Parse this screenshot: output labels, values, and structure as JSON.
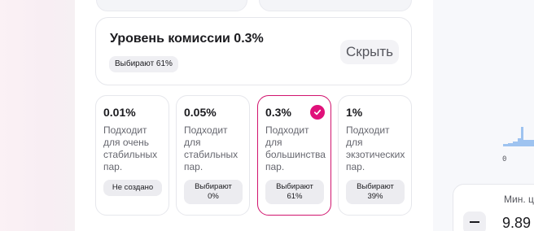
{
  "fee_summary": {
    "title": "Уровень комиссии 0.3%",
    "popularity": "Выбирают 61%",
    "hide_label": "Скрыть"
  },
  "tiers": [
    {
      "percent": "0.01%",
      "description": "Подходит\nдля очень\nстабильных\nпар.",
      "badge": "Не создано",
      "selected": false
    },
    {
      "percent": "0.05%",
      "description": "Подходит\nдля\nстабильных\nпар.",
      "badge_line1": "Выбирают",
      "badge_line2": "0%",
      "selected": false
    },
    {
      "percent": "0.3%",
      "description": "Подходит\nдля\nбольшинства\nпар.",
      "badge_line1": "Выбирают",
      "badge_line2": "61%",
      "selected": true
    },
    {
      "percent": "1%",
      "description": "Подходит\nдля\nэкзотических\nпар.",
      "badge_line1": "Выбирают",
      "badge_line2": "39%",
      "selected": false
    }
  ],
  "right_panel": {
    "axis_zero": "0",
    "min_label": "Мин. ц",
    "min_value": "9.89"
  },
  "colors": {
    "accent": "#e0117a",
    "selected_border": "#d1146e",
    "chart_bar": "#9ec3f0"
  },
  "icons": {
    "selected_check": "check-icon",
    "decrement": "minus-icon"
  }
}
